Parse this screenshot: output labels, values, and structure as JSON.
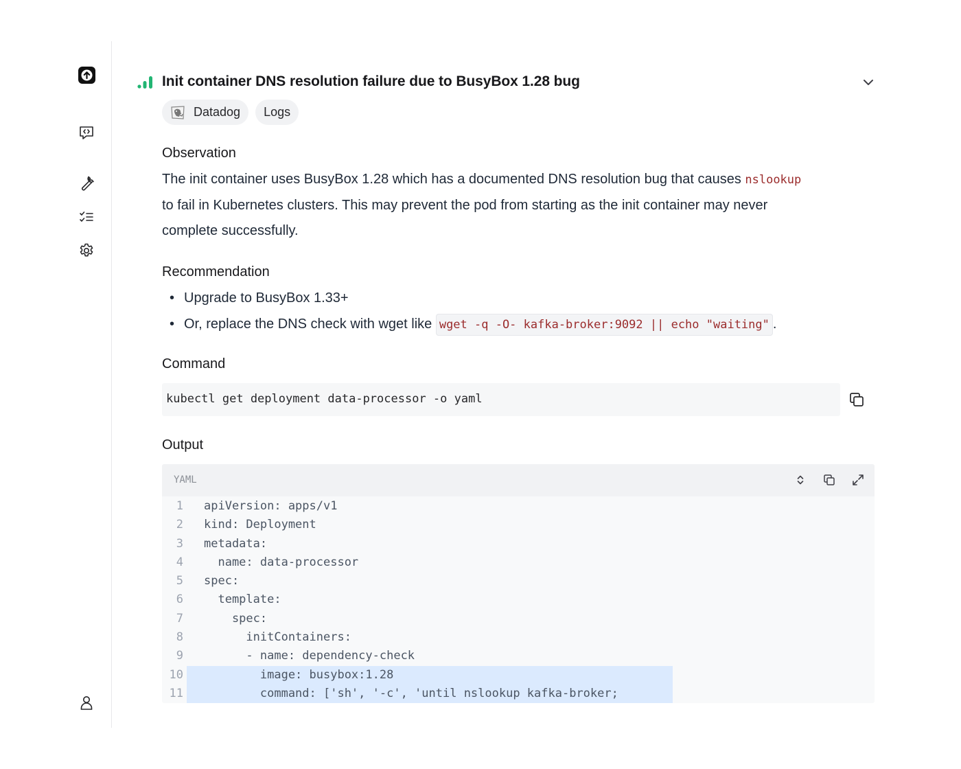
{
  "sidebar": {
    "icons": [
      "logo-icon",
      "chat-code-icon",
      "wrench-icon",
      "checklist-icon",
      "gear-icon",
      "user-icon"
    ]
  },
  "finding": {
    "title": "Init container DNS resolution failure due to BusyBox 1.28 bug",
    "tags": [
      "Datadog",
      "Logs"
    ],
    "observation_heading": "Observation",
    "observation_text_1": "The init container uses BusyBox 1.28 which has a documented DNS resolution bug that causes ",
    "observation_code": "nslookup",
    "observation_text_2": "to fail in Kubernetes clusters. This may prevent the pod from starting as the init container may never",
    "observation_text_3": "complete successfully.",
    "recommendation_heading": "Recommendation",
    "recommendation_1": "Upgrade to BusyBox 1.33+",
    "recommendation_2_prefix": "Or, replace the DNS check with wget like ",
    "recommendation_2_code": "wget -q -O- kafka-broker:9092 || echo \"waiting\"",
    "recommendation_2_suffix": ".",
    "command_heading": "Command",
    "command": "kubectl get deployment data-processor -o yaml",
    "output_heading": "Output",
    "output_language": "YAML",
    "output_lines": [
      {
        "n": "1",
        "text": "apiVersion: apps/v1"
      },
      {
        "n": "2",
        "text": "kind: Deployment"
      },
      {
        "n": "3",
        "text": "metadata:"
      },
      {
        "n": "4",
        "text": "  name: data-processor"
      },
      {
        "n": "5",
        "text": "spec:"
      },
      {
        "n": "6",
        "text": "  template:"
      },
      {
        "n": "7",
        "text": "    spec:"
      },
      {
        "n": "8",
        "text": "      initContainers:"
      },
      {
        "n": "9",
        "text": "      - name: dependency-check"
      },
      {
        "n": "10",
        "text": "        image: busybox:1.28"
      },
      {
        "n": "11",
        "text": "        command: ['sh', '-c', 'until nslookup kafka-broker;"
      }
    ],
    "highlighted_lines": [
      "10",
      "11"
    ]
  },
  "colors": {
    "severity_green": "#22b573",
    "code_red": "#9b2c2c",
    "highlight_blue": "#dbeafe"
  }
}
